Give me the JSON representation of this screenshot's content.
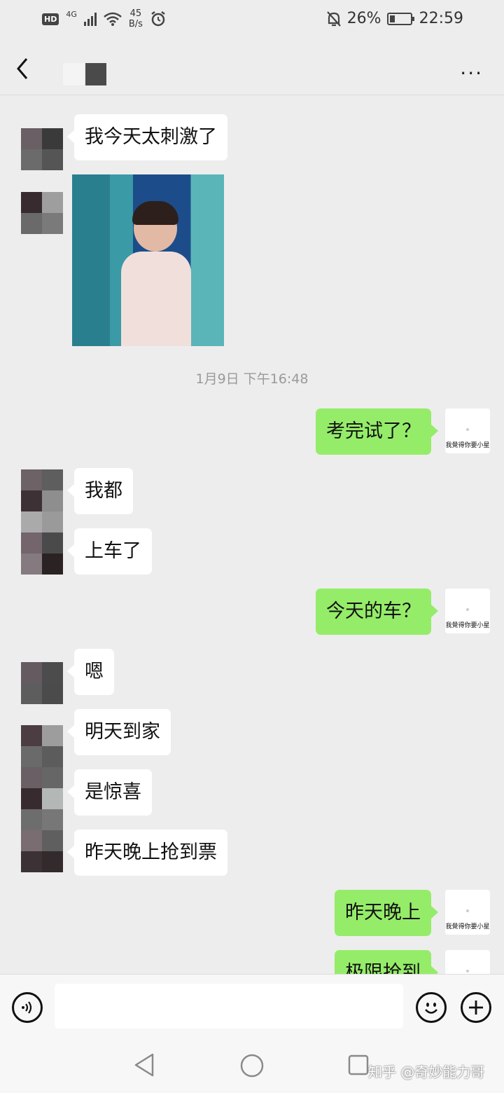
{
  "status_bar": {
    "hd": "HD",
    "network": "4G",
    "speed_value": "45",
    "speed_unit": "B/s",
    "battery": "26%",
    "battery_level": 0.26,
    "time": "22:59"
  },
  "nav": {
    "back_icon": "chevron-left-icon",
    "more": "···"
  },
  "messages": {
    "m1": "我今天太刺激了",
    "timestamp": "1月9日 下午16:48",
    "m2": "考完试了？",
    "m3": "我都",
    "m4": "上车了",
    "m5": "今天的车？",
    "m6": "嗯",
    "m7": "明天到家",
    "m8": "是惊喜",
    "m9": "昨天晚上抢到票",
    "m10": "昨天晚上",
    "m11": "极限抢到"
  },
  "self_avatar_caption": "我覺得你要小星",
  "input": {
    "voice_icon": "voice-icon",
    "emoji_icon": "emoji-icon",
    "plus_icon": "plus-icon"
  },
  "watermark": "知乎 @奇妙能力哥",
  "colors": {
    "background": "#ededed",
    "incoming_bubble": "#ffffff",
    "outgoing_bubble": "#95ec69"
  }
}
